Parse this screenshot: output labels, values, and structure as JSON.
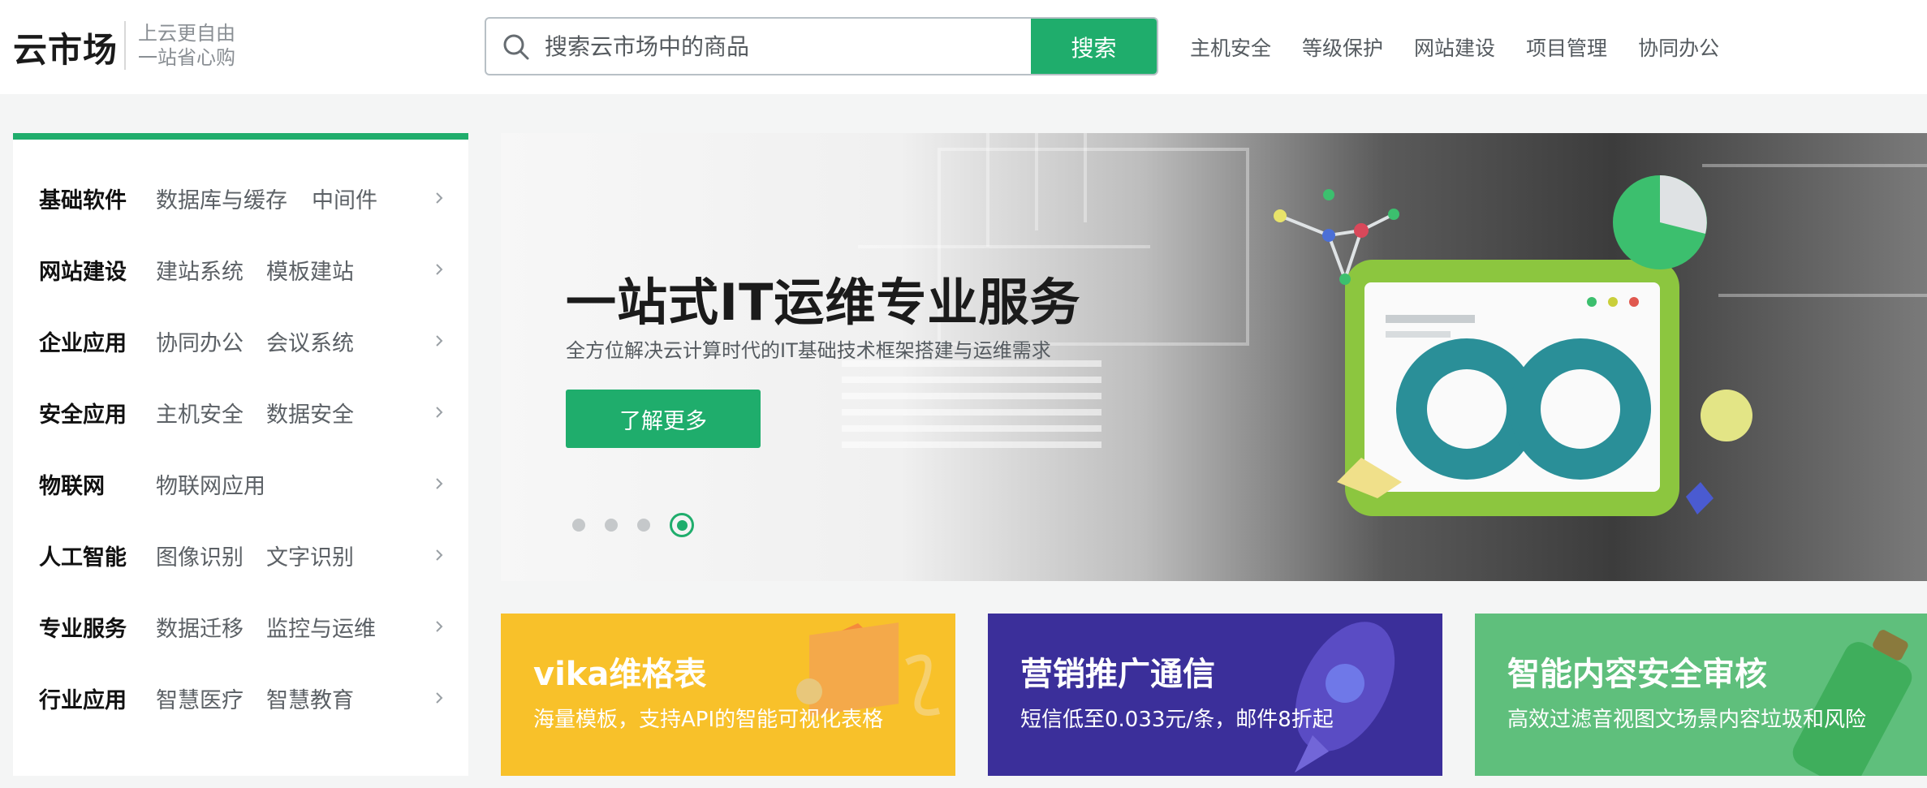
{
  "header": {
    "logo": "云市场",
    "slogan_line1": "上云更自由",
    "slogan_line2": "一站省心购",
    "search_placeholder": "搜索云市场中的商品",
    "search_button": "搜索",
    "nav": [
      "主机安全",
      "等级保护",
      "网站建设",
      "项目管理",
      "协同办公"
    ]
  },
  "categories": [
    {
      "title": "基础软件",
      "links": [
        "数据库与缓存",
        "中间件"
      ]
    },
    {
      "title": "网站建设",
      "links": [
        "建站系统",
        "模板建站"
      ]
    },
    {
      "title": "企业应用",
      "links": [
        "协同办公",
        "会议系统"
      ]
    },
    {
      "title": "安全应用",
      "links": [
        "主机安全",
        "数据安全"
      ]
    },
    {
      "title": "物联网",
      "links": [
        "物联网应用"
      ]
    },
    {
      "title": "人工智能",
      "links": [
        "图像识别",
        "文字识别"
      ]
    },
    {
      "title": "专业服务",
      "links": [
        "数据迁移",
        "监控与运维"
      ]
    },
    {
      "title": "行业应用",
      "links": [
        "智慧医疗",
        "智慧教育"
      ]
    }
  ],
  "banner": {
    "title": "一站式IT运维专业服务",
    "subtitle": "全方位解决云计算时代的IT基础技术框架搭建与运维需求",
    "button": "了解更多",
    "slide_count": 4,
    "active_slide": 4
  },
  "promos": [
    {
      "title": "vika维格表",
      "desc": "海量模板，支持API的智能可视化表格",
      "color": "#f8c12a"
    },
    {
      "title": "营销推广通信",
      "desc": "短信低至0.033元/条，邮件8折起",
      "color": "#3b2f9a"
    },
    {
      "title": "智能内容安全审核",
      "desc": "高效过滤音视图文场景内容垃圾和风险",
      "color": "#5fbf7c"
    }
  ],
  "colors": {
    "accent": "#1fad6c"
  }
}
